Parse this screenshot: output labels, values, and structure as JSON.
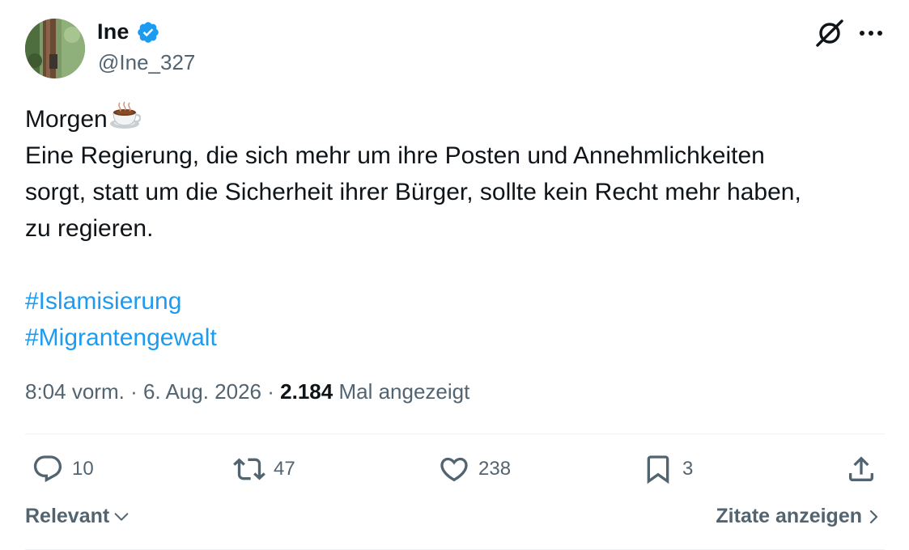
{
  "author": {
    "name": "Ine",
    "handle": "@Ine_327",
    "verified": true
  },
  "tweet": {
    "greeting": "Morgen",
    "greeting_emoji": "coffee-cup-icon",
    "lines": [
      "Eine Regierung, die sich mehr um ihre Posten und Annehmlichkeiten",
      "sorgt, statt um die Sicherheit ihrer Bürger, sollte kein Recht mehr haben,",
      "zu regieren."
    ],
    "hashtags": [
      "#Islamisierung",
      "#Migrantengewalt"
    ]
  },
  "meta": {
    "time": "8:04 vorm.",
    "separator": "·",
    "date": "6. Aug. 2026",
    "views_count": "2.184",
    "views_label": "Mal angezeigt"
  },
  "actions": {
    "replies": "10",
    "reposts": "47",
    "likes": "238",
    "bookmarks": "3"
  },
  "footer": {
    "sort_label": "Relevant",
    "quotes_label": "Zitate anzeigen"
  },
  "colors": {
    "accent": "#1d9bf0",
    "text": "#0f1419",
    "secondary": "#536471",
    "divider": "#eff3f4"
  }
}
